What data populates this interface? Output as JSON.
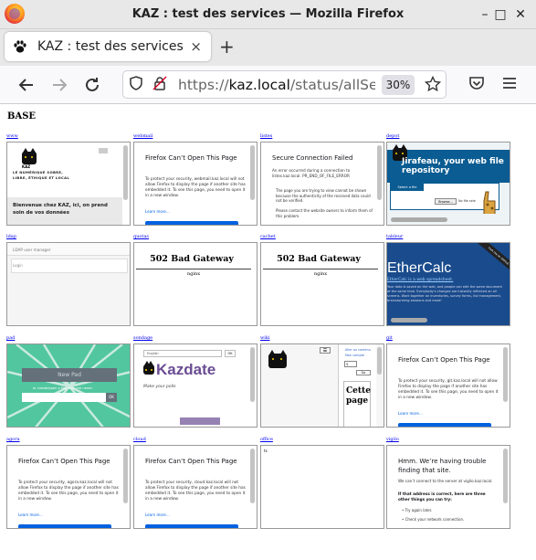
{
  "window": {
    "title": "KAZ : test des services — Mozilla Firefox",
    "controls": {
      "min": "–",
      "max": "□",
      "close": "✕"
    }
  },
  "tab": {
    "title": "KAZ : test des services",
    "close": "×",
    "new_tab": "+"
  },
  "toolbar": {
    "url_prefix": "https://",
    "url_host": "kaz.local",
    "url_path": "/status/allServ",
    "zoom": "30%"
  },
  "page": {
    "section_title": "BASE",
    "cells": [
      {
        "label": "www",
        "kind": "www",
        "tagline": "LE NUMÉRIQUE SOBRE, LIBRE, ÉTHIQUE ET LOCAL",
        "text": "Bienvenue chez KAZ, ici, on prend soin de vos données",
        "logo": "KAZ"
      },
      {
        "label": "webmail",
        "kind": "error",
        "heading": "Firefox Can’t Open This Page",
        "body": "To protect your security, webmail.kaz.local will not allow Firefox to display the page if another site has embedded it. To see this page, you need to open it in a new window.",
        "link": "Learn more…"
      },
      {
        "label": "listes",
        "kind": "secure",
        "heading": "Secure Connection Failed",
        "body": "An error occurred during a connection to listes.kaz.local. PR_END_OF_FILE_ERROR",
        "bullets": [
          "The page you are trying to view cannot be shown because the authenticity of the received data could not be verified.",
          "Please contact the website owners to inform them of this problem."
        ]
      },
      {
        "label": "depot",
        "kind": "depot",
        "heading": "Jirafeau, your web file repository",
        "select": "Select a file",
        "browse": "Browse...",
        "nofile": "No file sele"
      },
      {
        "label": "ldap",
        "kind": "ldap",
        "title": "LDAP user manager",
        "login": "Login"
      },
      {
        "label": "quotas",
        "kind": "gateway",
        "heading": "502 Bad Gateway",
        "server": "nginx"
      },
      {
        "label": "cachet",
        "kind": "gateway",
        "heading": "502 Bad Gateway",
        "server": "nginx"
      },
      {
        "label": "tableur",
        "kind": "ethercalc",
        "brand": "EtherCalc",
        "ribbon": "Fork me on GitHub",
        "link": "EtherCalc is a web spreadsheet.",
        "body": "Your data is saved on the web, and people can edit the same document at the same time. Everybody's changes are instantly reflected on all screens. Work together on inventories, survey forms, list management, brainstorming sessions and more!"
      },
      {
        "label": "pad",
        "kind": "pad",
        "button": "New Pad",
        "hint": "or create/open a Pad with the name:",
        "ok": "OK"
      },
      {
        "label": "sondage",
        "kind": "kazdate",
        "lang": "English",
        "ok": "OK",
        "brand": "Kazdate",
        "tagline": "Make your polls"
      },
      {
        "label": "wiki",
        "kind": "wiki",
        "menu": "☰",
        "search": "Go",
        "links": [
          "Aller au contenu",
          "Mon compte"
        ],
        "big": "Cette page"
      },
      {
        "label": "git",
        "kind": "error",
        "heading": "Firefox Can’t Open This Page",
        "body": "To protect your security, git.kaz.local will not allow Firefox to display the page if another site has embedded it. To see this page, you need to open it in a new window.",
        "link": "Learn more…"
      },
      {
        "label": "agora",
        "kind": "error",
        "heading": "Firefox Can’t Open This Page",
        "body": "To protect your security, agora.kaz.local will not allow Firefox to display the page if another site has embedded it. To see this page, you need to open it in a new window.",
        "link": "Learn more…"
      },
      {
        "label": "cloud",
        "kind": "error",
        "heading": "Firefox Can’t Open This Page",
        "body": "To protect your security, cloud.kaz.local will not allow Firefox to display the page if another site has embedded it. To see this page, you need to open it in a new window.",
        "link": "Learn more…"
      },
      {
        "label": "office",
        "kind": "blank",
        "text": "ts"
      },
      {
        "label": "vigilo",
        "kind": "trouble",
        "heading": "Hmm. We’re having trouble finding that site.",
        "body": "We can’t connect to the server at vigilo.kaz.local.",
        "strong": "If that address is correct, here are three other things you can try:",
        "bullets": [
          "Try again later.",
          "Check your network connection."
        ]
      }
    ]
  },
  "colors": {
    "link": "#0000ee",
    "firefox_blue": "#0061e0",
    "pad_green": "#51c69f",
    "ethercalc_blue": "#1a4b8c",
    "kazdate_purple": "#6a4c93",
    "jirafeau_blue": "#0b5c92"
  }
}
